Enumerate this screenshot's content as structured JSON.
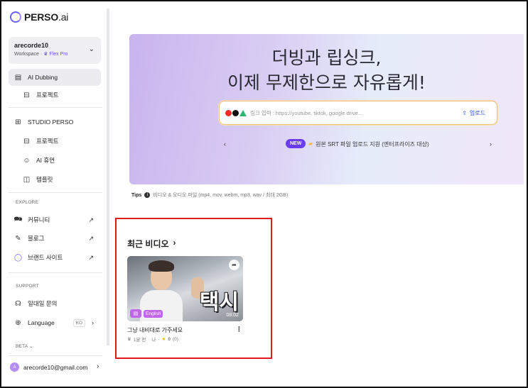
{
  "brand": {
    "logo_main": "PERSO",
    "logo_suffix": ".ai"
  },
  "workspace": {
    "name": "arecorde10",
    "label": "Workspace",
    "plan": "Flex Pro"
  },
  "nav": {
    "ai_dubbing": "AI Dubbing",
    "project": "프로젝트",
    "studio": "STUDIO PERSO",
    "studio_project": "프로젝트",
    "ai_human": "AI 휴먼",
    "template": "템플릿"
  },
  "explore": {
    "label": "EXPLORE",
    "items": [
      {
        "label": "커뮤니티"
      },
      {
        "label": "블로그"
      },
      {
        "label": "브랜드 사이트"
      }
    ]
  },
  "support": {
    "label": "SUPPORT",
    "contact": "일대일 문의",
    "language": "Language",
    "language_code": "KO"
  },
  "beta": {
    "label": "BETA"
  },
  "account": {
    "email": "arecorde10@gmail.com",
    "initial": "A"
  },
  "hero": {
    "title_line1": "더빙과 립싱크,",
    "title_line2": "이제 무제한으로 자유롭게!",
    "search_placeholder": "링크 입력 : https://youtube, tiktok, google drive...",
    "upload_label": "업로드",
    "notice_badge": "NEW",
    "notice_text": "원본 SRT 파일 업로드 지원 (엔터프라이즈 대상)"
  },
  "tips": {
    "label": "Tips",
    "text": "비디오 & 오디오 파일 (mp4, mov, webm, mp3, wav / 최대 2GB)"
  },
  "recent": {
    "title": "최근 비디오",
    "video": {
      "thumbnail_caption": "택시",
      "language": "English",
      "duration": "08:02",
      "title": "그냥 내비대로 가주세요",
      "meta_time": "1분 전",
      "meta_owner": "나",
      "rating": "0",
      "rating_count": "(0)"
    }
  },
  "colors": {
    "accent": "#6a3cf0",
    "highlight": "#e01a1a",
    "tag": "#c067e8"
  }
}
